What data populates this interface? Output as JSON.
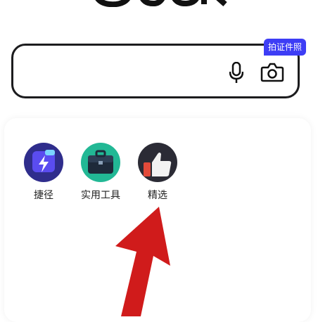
{
  "search": {
    "badge": "拍证件照",
    "mic_icon": "microphone-icon",
    "camera_icon": "camera-icon"
  },
  "tools": [
    {
      "label": "捷径",
      "icon": "shortcut-lightning-icon",
      "color": "#2f2d8c"
    },
    {
      "label": "实用工具",
      "icon": "toolbox-icon",
      "color": "#22b895"
    },
    {
      "label": "精选",
      "icon": "thumbs-up-icon",
      "color": "#2b2b35"
    }
  ],
  "annotation": {
    "icon": "red-arrow-pointer",
    "color": "#d01b1b"
  }
}
